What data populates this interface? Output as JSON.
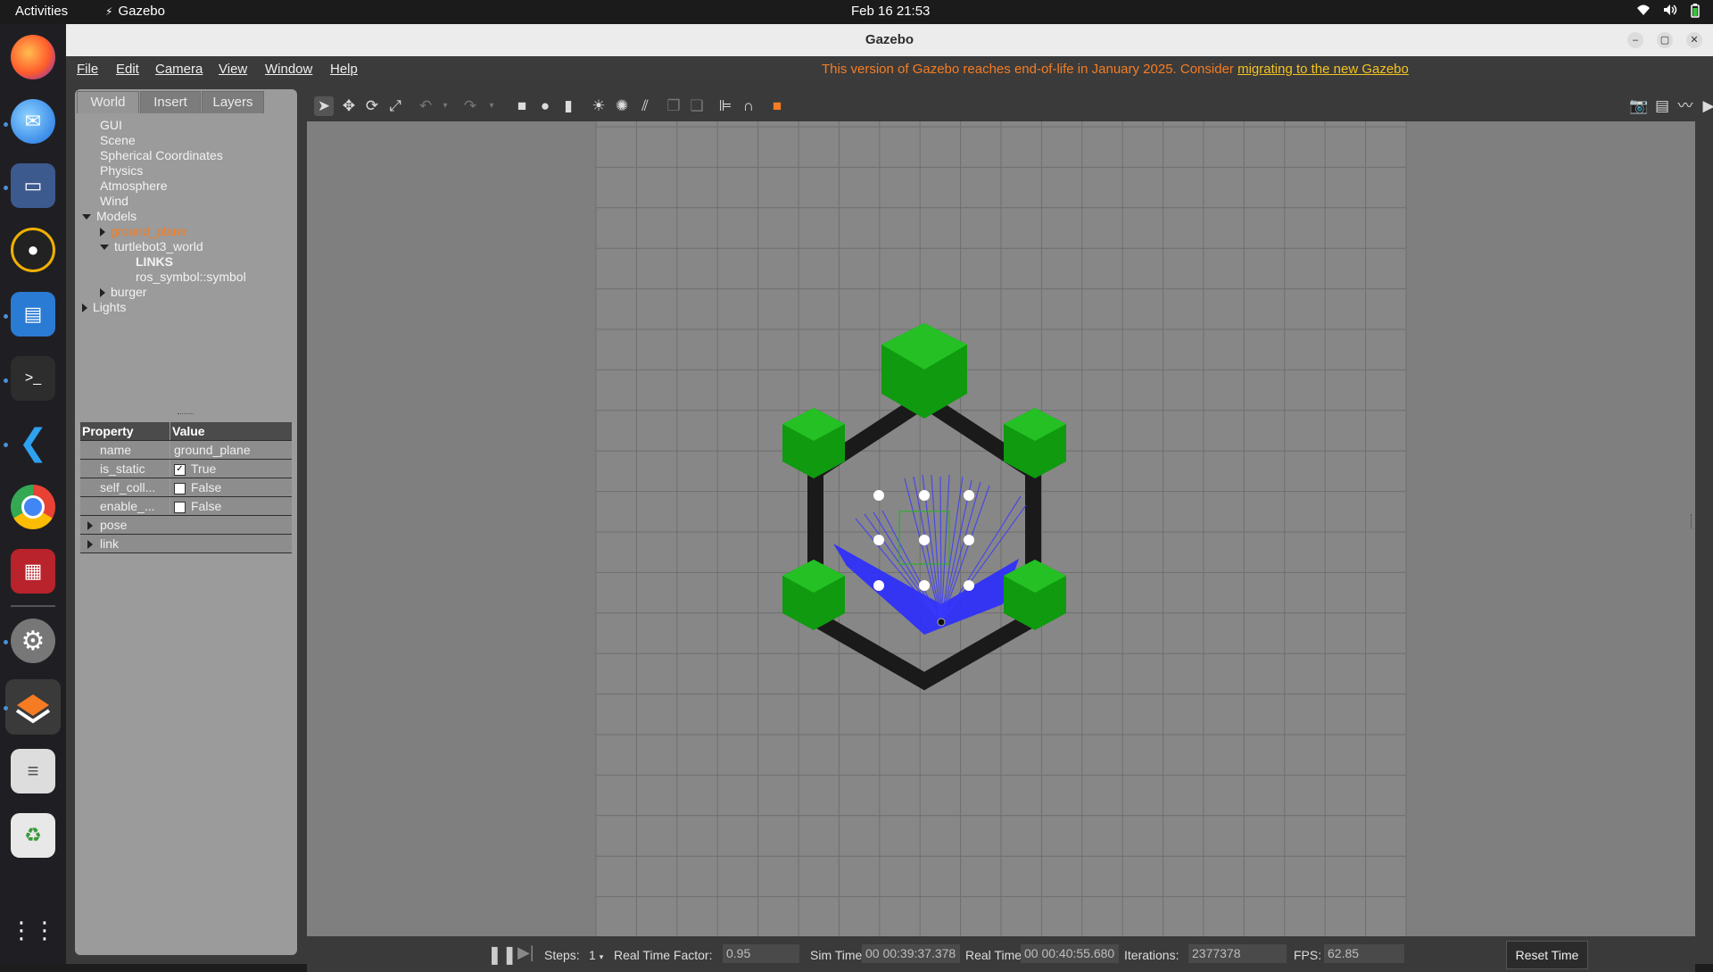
{
  "topbar": {
    "activities": "Activities",
    "app_name": "Gazebo",
    "clock": "Feb 16  21:53"
  },
  "dock": {
    "apps": [
      "Firefox",
      "Thunderbird",
      "Files",
      "Rhythmbox",
      "LibreOffice Writer",
      "Terminal",
      "Visual Studio Code",
      "Chrome",
      "App",
      "Settings",
      "Gazebo",
      "Text Editor",
      "Trash",
      "Show Applications"
    ]
  },
  "window": {
    "title": "Gazebo"
  },
  "menu": {
    "file": "File",
    "edit": "Edit",
    "camera": "Camera",
    "view": "View",
    "window": "Window",
    "help": "Help",
    "notice_text": "This version of Gazebo reaches end-of-life in January 2025. Consider",
    "notice_link": "migrating to the new Gazebo"
  },
  "tabs": {
    "world": "World",
    "insert": "Insert",
    "layers": "Layers"
  },
  "tree": {
    "gui": "GUI",
    "scene": "Scene",
    "spherical": "Spherical Coordinates",
    "physics": "Physics",
    "atmosphere": "Atmosphere",
    "wind": "Wind",
    "models": "Models",
    "ground_plane": "ground_plane",
    "turtlebot3_world": "turtlebot3_world",
    "links": "LINKS",
    "ros_symbol": "ros_symbol::symbol",
    "burger": "burger",
    "lights": "Lights"
  },
  "properties": {
    "header_property": "Property",
    "header_value": "Value",
    "rows": {
      "name_label": "name",
      "name_value": "ground_plane",
      "static_label": "is_static",
      "static_value": "True",
      "selfcoll_label": "self_coll...",
      "selfcoll_value": "False",
      "enable_label": "enable_...",
      "enable_value": "False"
    },
    "pose": "pose",
    "link": "link"
  },
  "status": {
    "steps_label": "Steps:",
    "steps_value": "1",
    "rtf_label": "Real Time Factor:",
    "rtf_value": "0.95",
    "sim_label": "Sim Time:",
    "sim_value": "00 00:39:37.378",
    "real_label": "Real Time:",
    "real_value": "00 00:40:55.680",
    "iter_label": "Iterations:",
    "iter_value": "2377378",
    "fps_label": "FPS:",
    "fps_value": "62.85",
    "reset": "Reset Time"
  },
  "colors": {
    "notice": "#f57c22",
    "link": "#f3c321",
    "selected_model": "#f57c22",
    "hex_green": "#12b012",
    "laser": "#1f1fff"
  }
}
